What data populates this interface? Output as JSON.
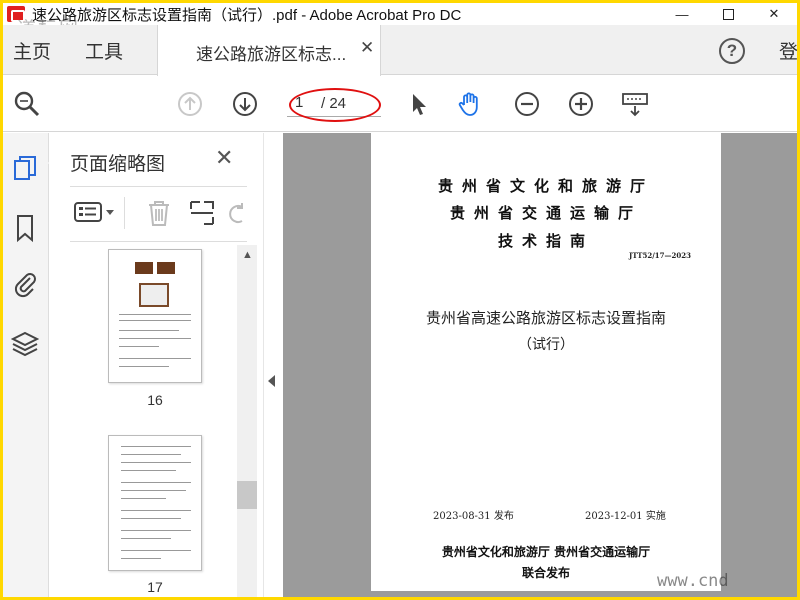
{
  "window": {
    "title": "速公路旅游区标志设置指南（试行）.pdf - Adobe Acrobat Pro DC",
    "watermark_top": "道标网",
    "minimize": "—",
    "close": "✕"
  },
  "menu": {
    "home": "主页",
    "tools": "工具",
    "tab_label": "速公路旅游区标志...",
    "tab_close": "✕",
    "help": "?",
    "signin": "登"
  },
  "toolbar": {
    "current_page": "1",
    "total_pages": "/ 24",
    "highlight_color": "#e01010"
  },
  "panel": {
    "title": "页面缩略图",
    "close": "✕",
    "thumbnails": [
      {
        "label": "16",
        "sign_left": "贵 G",
        "sign_right": "贵 G"
      },
      {
        "label": "17"
      }
    ]
  },
  "document": {
    "issuer_1": "贵州省文化和旅游厅",
    "issuer_2": "贵州省交通运输厅",
    "issuer_3": "技术指南",
    "std_code": "JTT52/17—2023",
    "title": "贵州省高速公路旅游区标志设置指南",
    "subtitle": "（试行）",
    "publish_date": "2023-08-31 发布",
    "effective_date": "2023-12-01  实施",
    "joint_org": "贵州省文化和旅游厅  贵州省交通运输厅",
    "joint_pub": "联合发布"
  },
  "watermark_bottom": "www.cnd",
  "colors": {
    "frame": "#ffd800",
    "accent_blue": "#2a6ad8",
    "hand_tool": "#1e73e8"
  }
}
